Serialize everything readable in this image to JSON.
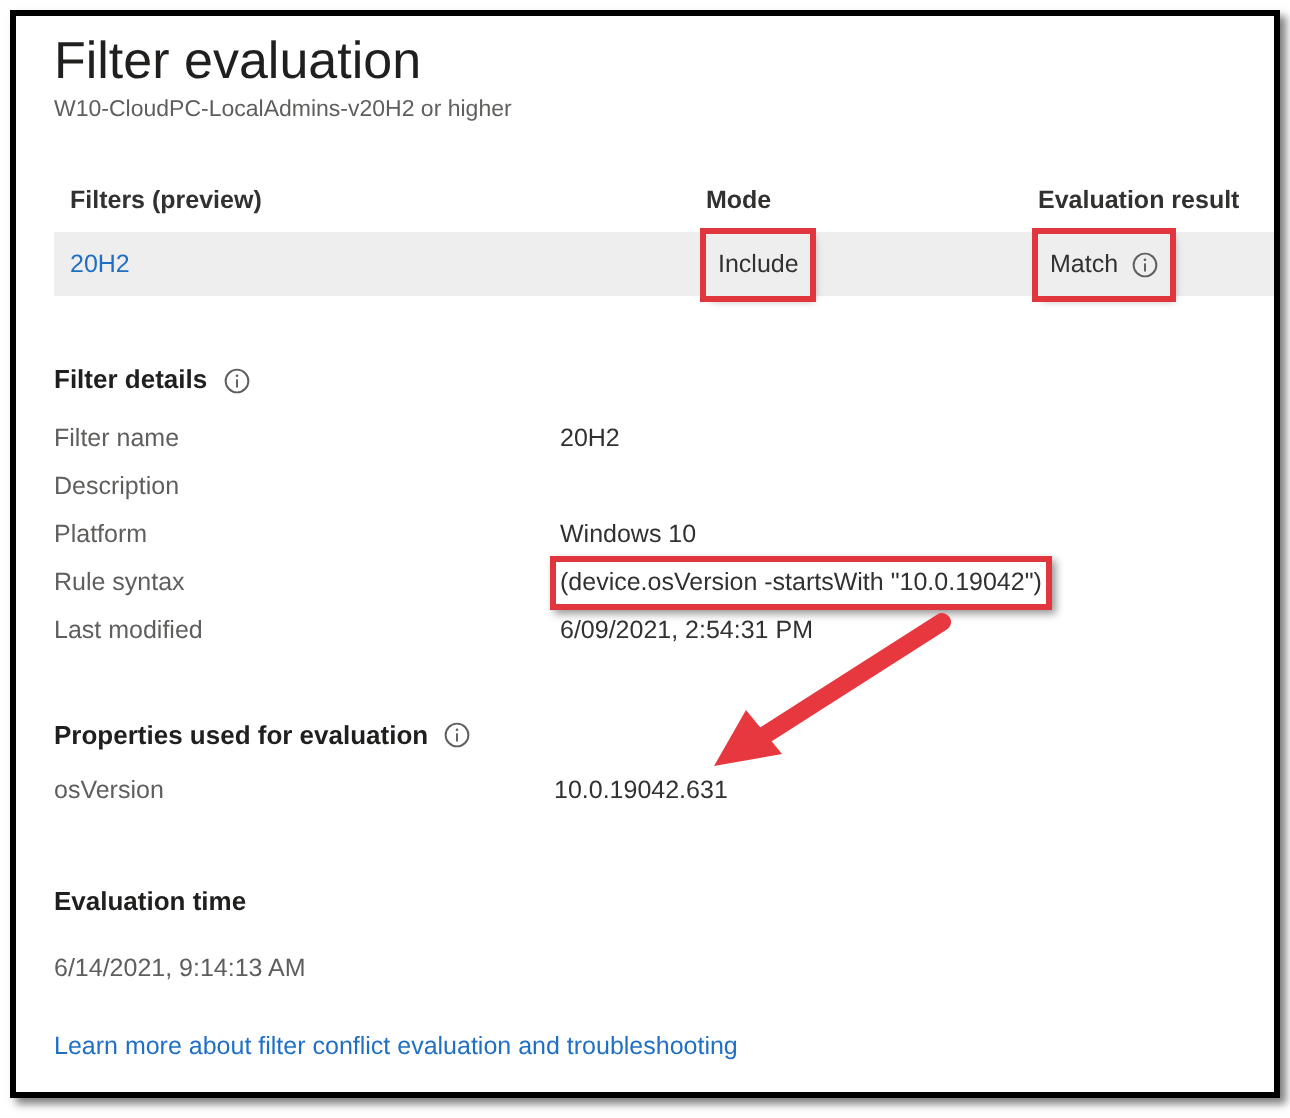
{
  "header": {
    "title": "Filter evaluation",
    "subtitle": "W10-CloudPC-LocalAdmins-v20H2 or higher"
  },
  "table": {
    "columns": [
      "Filters (preview)",
      "Mode",
      "Evaluation result"
    ],
    "rows": [
      {
        "filter": "20H2",
        "mode": "Include",
        "result": "Match",
        "mode_highlighted": true,
        "result_highlighted": true
      }
    ]
  },
  "filter_details": {
    "heading": "Filter details",
    "rows": [
      {
        "label": "Filter name",
        "value": "20H2",
        "highlighted": false
      },
      {
        "label": "Description",
        "highlighted": false
      },
      {
        "label": "Platform",
        "value": "Windows 10",
        "highlighted": false
      },
      {
        "label": "Rule syntax",
        "value": "(device.osVersion -startsWith \"10.0.19042\")",
        "highlighted": true
      },
      {
        "label": "Last modified",
        "value": "6/09/2021, 2:54:31 PM",
        "highlighted": false
      }
    ]
  },
  "properties": {
    "heading": "Properties used for evaluation",
    "rows": [
      {
        "label": "osVersion",
        "value": "10.0.19042.631"
      }
    ]
  },
  "evaluation_time": {
    "heading": "Evaluation time",
    "value": "6/14/2021, 9:14:13 AM"
  },
  "link": "Learn more about filter conflict evaluation and troubleshooting"
}
